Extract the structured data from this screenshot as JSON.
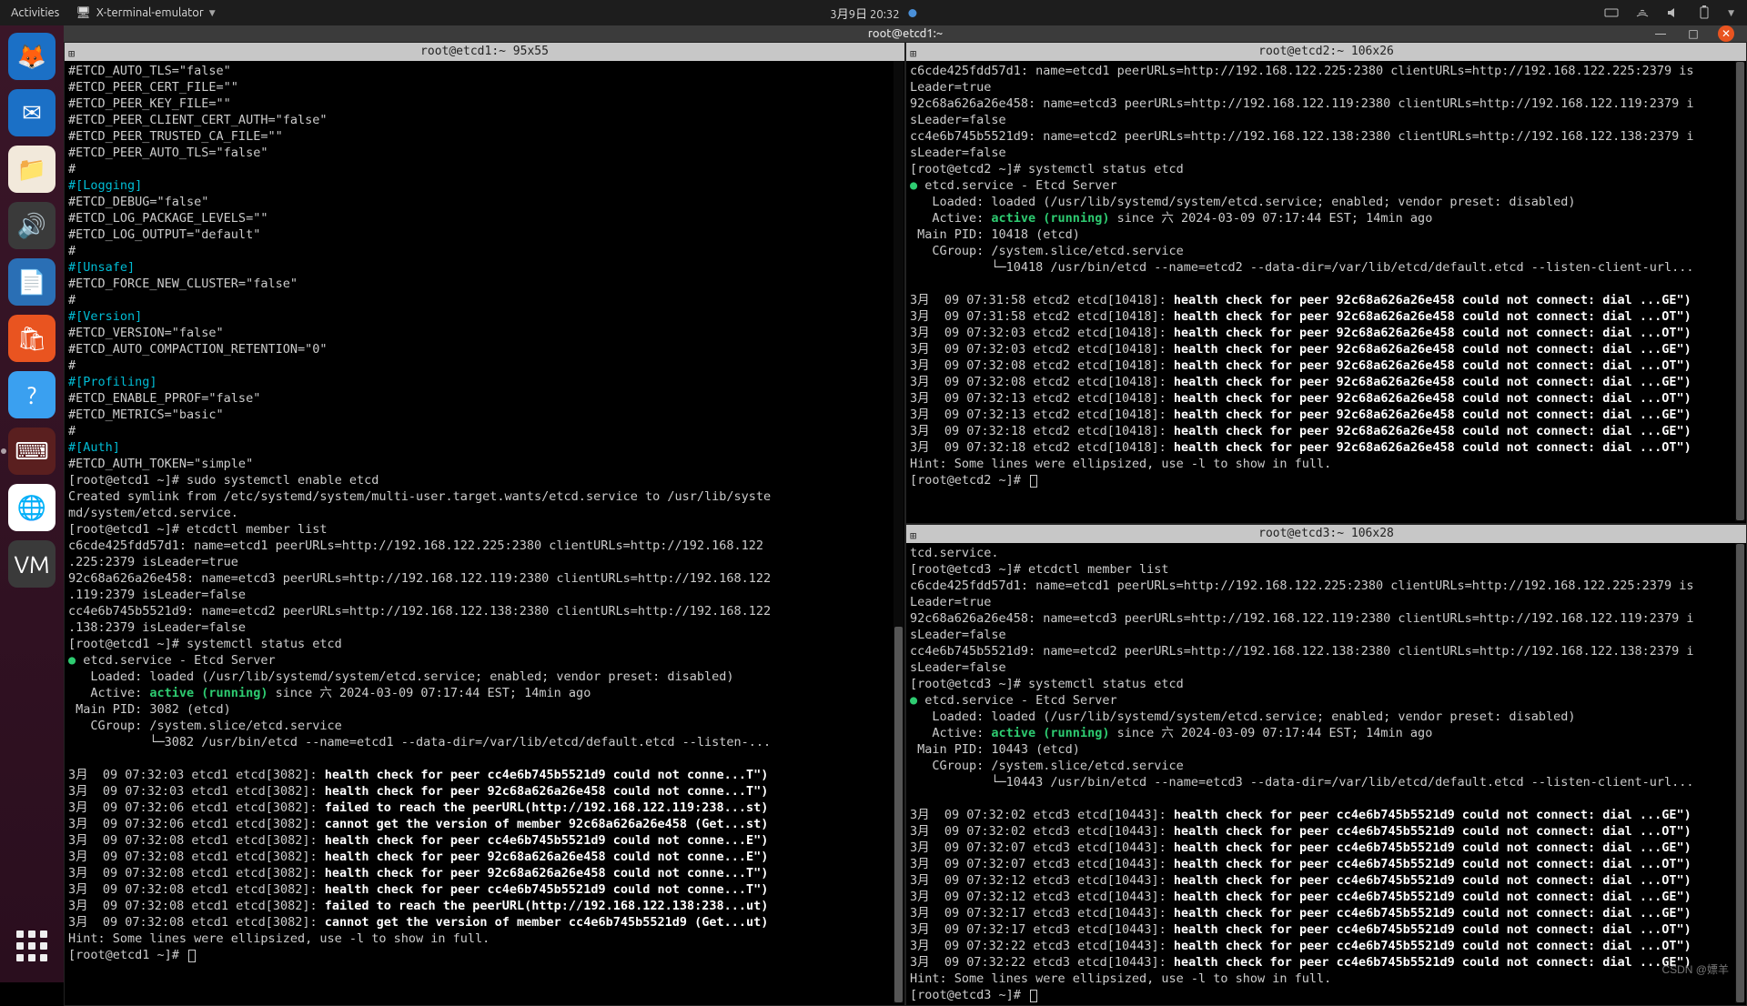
{
  "topbar": {
    "activities": "Activities",
    "app_name": "X-terminal-emulator",
    "clock": "3月9日  20:32"
  },
  "dock": {
    "items": [
      {
        "name": "firefox",
        "bg": "#1b70c6",
        "glyph": "🦊"
      },
      {
        "name": "thunderbird",
        "bg": "#1b70c6",
        "glyph": "✉"
      },
      {
        "name": "files",
        "bg": "#f2e9db",
        "glyph": "📁"
      },
      {
        "name": "rhythmbox",
        "bg": "#3a3a3a",
        "glyph": "🔊"
      },
      {
        "name": "text",
        "bg": "#2a6fb5",
        "glyph": "📄"
      },
      {
        "name": "software",
        "bg": "#e95420",
        "glyph": "🛍"
      },
      {
        "name": "help",
        "bg": "#3aa0f0",
        "glyph": "?"
      },
      {
        "name": "terminal",
        "bg": "#5a1f1f",
        "glyph": "⌨",
        "active": true
      },
      {
        "name": "chrome",
        "bg": "#fff",
        "glyph": "🌐"
      },
      {
        "name": "vm",
        "bg": "#3a3a3a",
        "glyph": "VM"
      }
    ]
  },
  "window": {
    "title": "root@etcd1:~"
  },
  "panes": {
    "left": {
      "title": "root@etcd1:~ 95x55",
      "config_lines": [
        "#ETCD_AUTO_TLS=\"false\"",
        "#ETCD_PEER_CERT_FILE=\"\"",
        "#ETCD_PEER_KEY_FILE=\"\"",
        "#ETCD_PEER_CLIENT_CERT_AUTH=\"false\"",
        "#ETCD_PEER_TRUSTED_CA_FILE=\"\"",
        "#ETCD_PEER_AUTO_TLS=\"false\"",
        "#"
      ],
      "sections": [
        {
          "head": "#[Logging]",
          "lines": [
            "#ETCD_DEBUG=\"false\"",
            "#ETCD_LOG_PACKAGE_LEVELS=\"\"",
            "#ETCD_LOG_OUTPUT=\"default\"",
            "#"
          ]
        },
        {
          "head": "#[Unsafe]",
          "lines": [
            "#ETCD_FORCE_NEW_CLUSTER=\"false\"",
            "#"
          ]
        },
        {
          "head": "#[Version]",
          "lines": [
            "#ETCD_VERSION=\"false\"",
            "#ETCD_AUTO_COMPACTION_RETENTION=\"0\"",
            "#"
          ]
        },
        {
          "head": "#[Profiling]",
          "lines": [
            "#ETCD_ENABLE_PPROF=\"false\"",
            "#ETCD_METRICS=\"basic\"",
            "#"
          ]
        },
        {
          "head": "#[Auth]",
          "lines": [
            "#ETCD_AUTH_TOKEN=\"simple\""
          ]
        }
      ],
      "cmd_enable_prompt": "[root@etcd1 ~]# ",
      "cmd_enable": "sudo systemctl enable etcd",
      "enable_out": "Created symlink from /etc/systemd/system/multi-user.target.wants/etcd.service to /usr/lib/syste\nmd/system/etcd.service.",
      "cmd_member_prompt": "[root@etcd1 ~]# ",
      "cmd_member": "etcdctl member list",
      "members": [
        "c6cde425fdd57d1: name=etcd1 peerURLs=http://192.168.122.225:2380 clientURLs=http://192.168.122\n.225:2379 isLeader=true",
        "92c68a626a26e458: name=etcd3 peerURLs=http://192.168.122.119:2380 clientURLs=http://192.168.122\n.119:2379 isLeader=false",
        "cc4e6b745b5521d9: name=etcd2 peerURLs=http://192.168.122.138:2380 clientURLs=http://192.168.122\n.138:2379 isLeader=false"
      ],
      "cmd_status_prompt": "[root@etcd1 ~]# ",
      "cmd_status": "systemctl status etcd",
      "svc_line": "etcd.service - Etcd Server",
      "loaded": "   Loaded: loaded (/usr/lib/systemd/system/etcd.service; enabled; vendor preset: disabled)",
      "active_prefix": "   Active: ",
      "active_state": "active (running)",
      "active_suffix": " since 六 2024-03-09 07:17:44 EST; 14min ago",
      "mainpid": " Main PID: 3082 (etcd)",
      "cgroup": "   CGroup: /system.slice/etcd.service",
      "cgroup_sub": "           └─3082 /usr/bin/etcd --name=etcd1 --data-dir=/var/lib/etcd/default.etcd --listen-...",
      "logs": [
        {
          "p": "3月  09 07:32:03 etcd1 etcd[3082]: ",
          "m": "health check for peer cc4e6b745b5521d9 could not conne...T\")"
        },
        {
          "p": "3月  09 07:32:03 etcd1 etcd[3082]: ",
          "m": "health check for peer 92c68a626a26e458 could not conne...T\")"
        },
        {
          "p": "3月  09 07:32:06 etcd1 etcd[3082]: ",
          "m": "failed to reach the peerURL(http://192.168.122.119:238...st)"
        },
        {
          "p": "3月  09 07:32:06 etcd1 etcd[3082]: ",
          "m": "cannot get the version of member 92c68a626a26e458 (Get...st)"
        },
        {
          "p": "3月  09 07:32:08 etcd1 etcd[3082]: ",
          "m": "health check for peer cc4e6b745b5521d9 could not conne...E\")"
        },
        {
          "p": "3月  09 07:32:08 etcd1 etcd[3082]: ",
          "m": "health check for peer 92c68a626a26e458 could not conne...E\")"
        },
        {
          "p": "3月  09 07:32:08 etcd1 etcd[3082]: ",
          "m": "health check for peer 92c68a626a26e458 could not conne...T\")"
        },
        {
          "p": "3月  09 07:32:08 etcd1 etcd[3082]: ",
          "m": "health check for peer cc4e6b745b5521d9 could not conne...T\")"
        },
        {
          "p": "3月  09 07:32:08 etcd1 etcd[3082]: ",
          "m": "failed to reach the peerURL(http://192.168.122.138:238...ut)"
        },
        {
          "p": "3月  09 07:32:08 etcd1 etcd[3082]: ",
          "m": "cannot get the version of member cc4e6b745b5521d9 (Get...ut)"
        }
      ],
      "hint": "Hint: Some lines were ellipsized, use -l to show in full.",
      "final_prompt": "[root@etcd1 ~]# "
    },
    "tr": {
      "title": "root@etcd2:~ 106x26",
      "members": [
        "c6cde425fdd57d1: name=etcd1 peerURLs=http://192.168.122.225:2380 clientURLs=http://192.168.122.225:2379 is\nLeader=true",
        "92c68a626a26e458: name=etcd3 peerURLs=http://192.168.122.119:2380 clientURLs=http://192.168.122.119:2379 i\nsLeader=false",
        "cc4e6b745b5521d9: name=etcd2 peerURLs=http://192.168.122.138:2380 clientURLs=http://192.168.122.138:2379 i\nsLeader=false"
      ],
      "cmd_status_prompt": "[root@etcd2 ~]# ",
      "cmd_status": "systemctl status etcd",
      "svc_line": "etcd.service - Etcd Server",
      "loaded": "   Loaded: loaded (/usr/lib/systemd/system/etcd.service; enabled; vendor preset: disabled)",
      "active_prefix": "   Active: ",
      "active_state": "active (running)",
      "active_suffix": " since 六 2024-03-09 07:17:44 EST; 14min ago",
      "mainpid": " Main PID: 10418 (etcd)",
      "cgroup": "   CGroup: /system.slice/etcd.service",
      "cgroup_sub": "           └─10418 /usr/bin/etcd --name=etcd2 --data-dir=/var/lib/etcd/default.etcd --listen-client-url...",
      "logs": [
        {
          "p": "3月  09 07:31:58 etcd2 etcd[10418]: ",
          "m": "health check for peer 92c68a626a26e458 could not connect: dial ...GE\")"
        },
        {
          "p": "3月  09 07:31:58 etcd2 etcd[10418]: ",
          "m": "health check for peer 92c68a626a26e458 could not connect: dial ...OT\")"
        },
        {
          "p": "3月  09 07:32:03 etcd2 etcd[10418]: ",
          "m": "health check for peer 92c68a626a26e458 could not connect: dial ...OT\")"
        },
        {
          "p": "3月  09 07:32:03 etcd2 etcd[10418]: ",
          "m": "health check for peer 92c68a626a26e458 could not connect: dial ...GE\")"
        },
        {
          "p": "3月  09 07:32:08 etcd2 etcd[10418]: ",
          "m": "health check for peer 92c68a626a26e458 could not connect: dial ...OT\")"
        },
        {
          "p": "3月  09 07:32:08 etcd2 etcd[10418]: ",
          "m": "health check for peer 92c68a626a26e458 could not connect: dial ...GE\")"
        },
        {
          "p": "3月  09 07:32:13 etcd2 etcd[10418]: ",
          "m": "health check for peer 92c68a626a26e458 could not connect: dial ...OT\")"
        },
        {
          "p": "3月  09 07:32:13 etcd2 etcd[10418]: ",
          "m": "health check for peer 92c68a626a26e458 could not connect: dial ...GE\")"
        },
        {
          "p": "3月  09 07:32:18 etcd2 etcd[10418]: ",
          "m": "health check for peer 92c68a626a26e458 could not connect: dial ...GE\")"
        },
        {
          "p": "3月  09 07:32:18 etcd2 etcd[10418]: ",
          "m": "health check for peer 92c68a626a26e458 could not connect: dial ...OT\")"
        }
      ],
      "hint": "Hint: Some lines were ellipsized, use -l to show in full.",
      "final_prompt": "[root@etcd2 ~]# "
    },
    "br": {
      "title": "root@etcd3:~ 106x28",
      "preline": "tcd.service.",
      "cmd_member_prompt": "[root@etcd3 ~]# ",
      "cmd_member": "etcdctl member list",
      "members": [
        "c6cde425fdd57d1: name=etcd1 peerURLs=http://192.168.122.225:2380 clientURLs=http://192.168.122.225:2379 is\nLeader=true",
        "92c68a626a26e458: name=etcd3 peerURLs=http://192.168.122.119:2380 clientURLs=http://192.168.122.119:2379 i\nsLeader=false",
        "cc4e6b745b5521d9: name=etcd2 peerURLs=http://192.168.122.138:2380 clientURLs=http://192.168.122.138:2379 i\nsLeader=false"
      ],
      "cmd_status_prompt": "[root@etcd3 ~]# ",
      "cmd_status": "systemctl status etcd",
      "svc_line": "etcd.service - Etcd Server",
      "loaded": "   Loaded: loaded (/usr/lib/systemd/system/etcd.service; enabled; vendor preset: disabled)",
      "active_prefix": "   Active: ",
      "active_state": "active (running)",
      "active_suffix": " since 六 2024-03-09 07:17:44 EST; 14min ago",
      "mainpid": " Main PID: 10443 (etcd)",
      "cgroup": "   CGroup: /system.slice/etcd.service",
      "cgroup_sub": "           └─10443 /usr/bin/etcd --name=etcd3 --data-dir=/var/lib/etcd/default.etcd --listen-client-url...",
      "logs": [
        {
          "p": "3月  09 07:32:02 etcd3 etcd[10443]: ",
          "m": "health check for peer cc4e6b745b5521d9 could not connect: dial ...GE\")"
        },
        {
          "p": "3月  09 07:32:02 etcd3 etcd[10443]: ",
          "m": "health check for peer cc4e6b745b5521d9 could not connect: dial ...OT\")"
        },
        {
          "p": "3月  09 07:32:07 etcd3 etcd[10443]: ",
          "m": "health check for peer cc4e6b745b5521d9 could not connect: dial ...GE\")"
        },
        {
          "p": "3月  09 07:32:07 etcd3 etcd[10443]: ",
          "m": "health check for peer cc4e6b745b5521d9 could not connect: dial ...OT\")"
        },
        {
          "p": "3月  09 07:32:12 etcd3 etcd[10443]: ",
          "m": "health check for peer cc4e6b745b5521d9 could not connect: dial ...OT\")"
        },
        {
          "p": "3月  09 07:32:12 etcd3 etcd[10443]: ",
          "m": "health check for peer cc4e6b745b5521d9 could not connect: dial ...GE\")"
        },
        {
          "p": "3月  09 07:32:17 etcd3 etcd[10443]: ",
          "m": "health check for peer cc4e6b745b5521d9 could not connect: dial ...GE\")"
        },
        {
          "p": "3月  09 07:32:17 etcd3 etcd[10443]: ",
          "m": "health check for peer cc4e6b745b5521d9 could not connect: dial ...OT\")"
        },
        {
          "p": "3月  09 07:32:22 etcd3 etcd[10443]: ",
          "m": "health check for peer cc4e6b745b5521d9 could not connect: dial ...OT\")"
        },
        {
          "p": "3月  09 07:32:22 etcd3 etcd[10443]: ",
          "m": "health check for peer cc4e6b745b5521d9 could not connect: dial ...GE\")"
        }
      ],
      "hint": "Hint: Some lines were ellipsized, use -l to show in full.",
      "final_prompt": "[root@etcd3 ~]# "
    }
  },
  "watermark": "CSDN @嫖羊"
}
